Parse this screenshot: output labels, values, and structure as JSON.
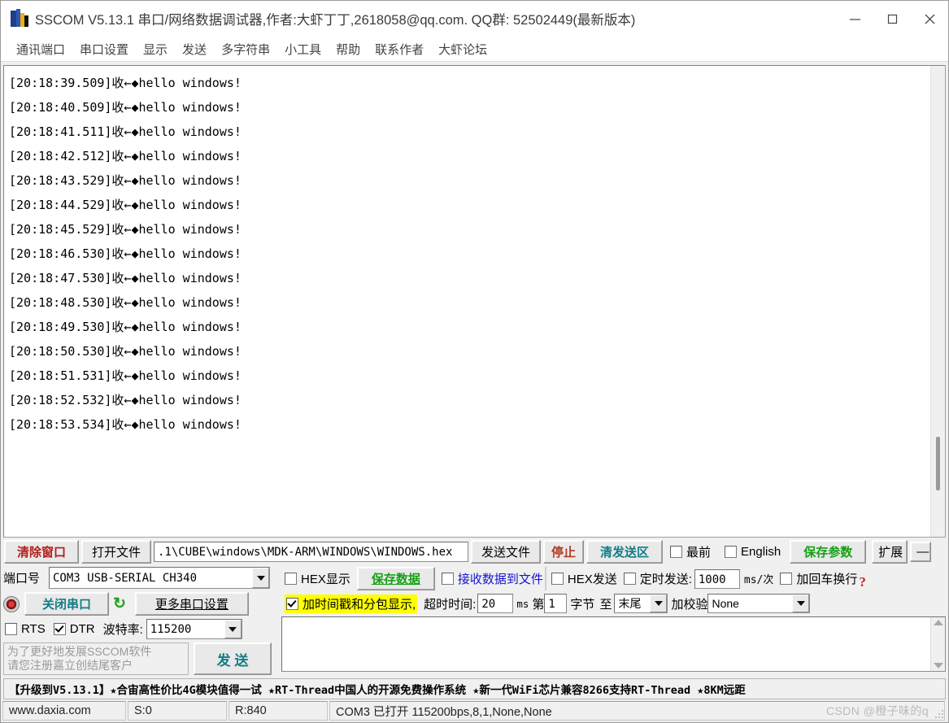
{
  "window": {
    "title": "SSCOM V5.13.1 串口/网络数据调试器,作者:大虾丁丁,2618058@qq.com. QQ群: 52502449(最新版本)",
    "minimize": "—",
    "maximize": "□",
    "close": "✕"
  },
  "menu": {
    "items": [
      {
        "label": "通讯端口"
      },
      {
        "label": "串口设置"
      },
      {
        "label": "显示"
      },
      {
        "label": "发送"
      },
      {
        "label": "多字符串"
      },
      {
        "label": "小工具"
      },
      {
        "label": "帮助"
      },
      {
        "label": "联系作者"
      },
      {
        "label": "大虾论坛"
      }
    ]
  },
  "terminal": {
    "lines": [
      "[20:18:39.509]收←◆hello windows!",
      "[20:18:40.509]收←◆hello windows!",
      "[20:18:41.511]收←◆hello windows!",
      "[20:18:42.512]收←◆hello windows!",
      "[20:18:43.529]收←◆hello windows!",
      "[20:18:44.529]收←◆hello windows!",
      "[20:18:45.529]收←◆hello windows!",
      "[20:18:46.530]收←◆hello windows!",
      "[20:18:47.530]收←◆hello windows!",
      "[20:18:48.530]收←◆hello windows!",
      "[20:18:49.530]收←◆hello windows!",
      "[20:18:50.530]收←◆hello windows!",
      "[20:18:51.531]收←◆hello windows!",
      "[20:18:52.532]收←◆hello windows!",
      "[20:18:53.534]收←◆hello windows!"
    ]
  },
  "toolbar": {
    "clear_window": "清除窗口",
    "open_file": "打开文件",
    "file_path": ".1\\CUBE\\windows\\MDK-ARM\\WINDOWS\\WINDOWS.hex",
    "send_file": "发送文件",
    "stop": "停止",
    "clear_send": "清发送区",
    "topmost": "最前",
    "english": "English",
    "save_params": "保存参数",
    "extend": "扩展",
    "collapse": "—"
  },
  "port": {
    "port_label": "端口号",
    "port_value": "COM3 USB-SERIAL CH340",
    "close_port": "关闭串口",
    "refresh": "↻",
    "more_settings": "更多串口设置",
    "rts": "RTS",
    "dtr": "DTR",
    "baud_label": "波特率:",
    "baud_value": "115200",
    "register_note_line1": "为了更好地发展SSCOM软件",
    "register_note_line2": "请您注册嘉立创结尾客户",
    "send_button": "发 送"
  },
  "receive": {
    "hex_display": "HEX显示",
    "save_data": "保存数据",
    "recv_to_file": "接收数据到文件",
    "timestamp_display": "加时间戳和分包显示,",
    "timeout_label": "超时时间:",
    "timeout_value": "20",
    "timeout_unit": "ms",
    "byte_prefix": "第",
    "byte_index": "1",
    "byte_label": "字节",
    "to_label": "至",
    "to_value": "末尾",
    "checksum_label": "加校验",
    "checksum_value": "None"
  },
  "send": {
    "hex_send": "HEX发送",
    "timed_send": "定时发送:",
    "interval_value": "1000",
    "interval_unit": "ms/次",
    "add_crlf": "加回车换行",
    "help_mark": "?",
    "content": ""
  },
  "promo": {
    "text": "【升级到V5.13.1】★合宙高性价比4G模块值得一试 ★RT-Thread中国人的开源免费操作系统 ★新一代WiFi芯片兼容8266支持RT-Thread ★8KM远距"
  },
  "statusbar": {
    "site": "www.daxia.com",
    "sent": "S:0",
    "received": "R:840",
    "connection": "COM3 已打开  115200bps,8,1,None,None",
    "watermark": "CSDN @橙子味的q"
  },
  "colors": {
    "accent_red": "#b21e1e",
    "accent_teal": "#127d86",
    "accent_green": "#14a014",
    "highlight_yellow": "#ffff00",
    "link_blue": "#1414d2"
  }
}
